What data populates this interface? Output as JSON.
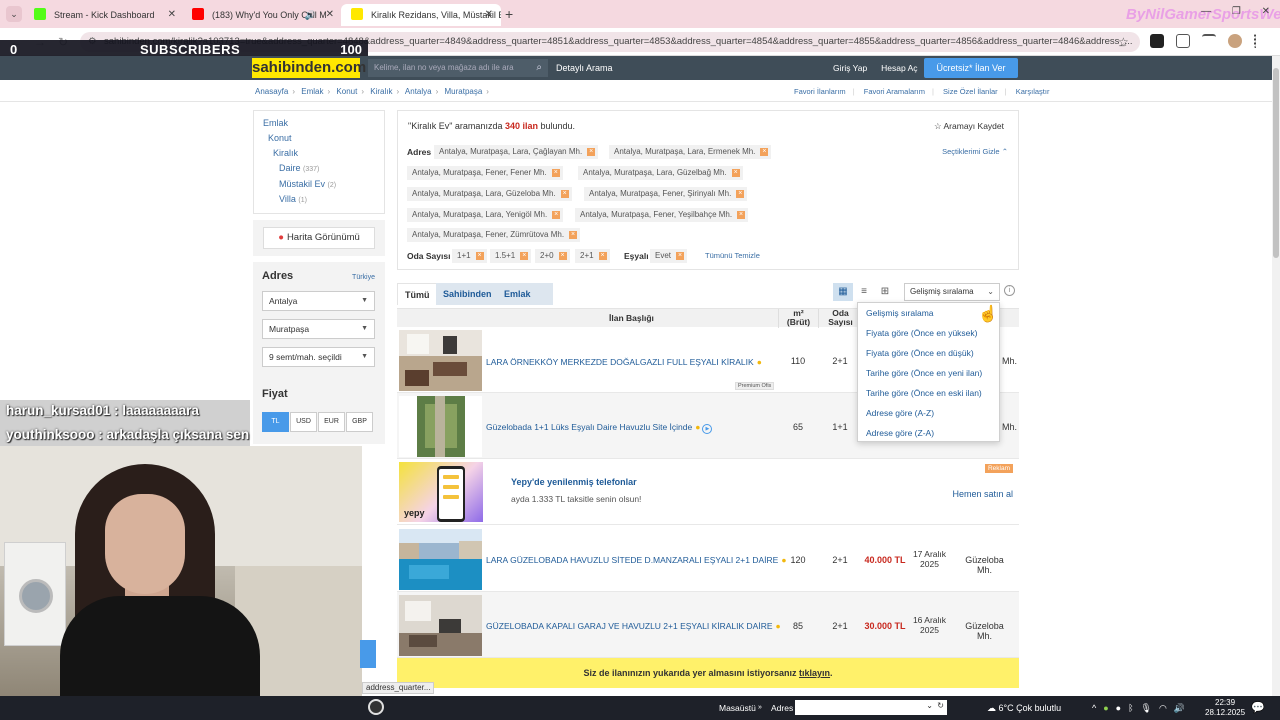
{
  "browser": {
    "tabs": [
      {
        "title": "Stream - Kick Dashboard",
        "favicon_color": "#53fc18",
        "active": false
      },
      {
        "title": "(183) Why'd You Only Call M",
        "favicon_color": "#ff0000",
        "active": false
      },
      {
        "title": "Kiralık Rezidans, Villa, Müstakil E",
        "favicon_color": "#ffe800",
        "active": true
      }
    ],
    "url": "sahibinden.com/kiralik?a103713=true&address_quarter=4848&address_quarter=4849&address_quarter=4851&address_quarter=4853&address_quarter=4854&address_quarter=4855&address_quarter=4856&address_quarter=4846&address_...",
    "watermark": "ByNilGamerSportsWeb"
  },
  "overlay": {
    "sub_left": "0",
    "sub_label": "SUBSCRIBERS",
    "sub_right": "100",
    "chat": [
      {
        "user": "harun_kursad01",
        "text": "laaaaaaaara"
      },
      {
        "user": "youthinksooo",
        "text": "arkadaşla çıksana sen"
      }
    ],
    "url_tooltip": "address_quarter..."
  },
  "header": {
    "logo": "sahibinden.com",
    "search_placeholder": "Kelime, ilan no veya mağaza adı ile ara",
    "detailed_search": "Detaylı Arama",
    "login": "Giriş Yap",
    "register": "Hesap Aç",
    "free_ad": "Ücretsiz* İlan Ver"
  },
  "breadcrumb": [
    "Anasayfa",
    "Emlak",
    "Konut",
    "Kiralık",
    "Antalya",
    "Muratpaşa"
  ],
  "fav_links": [
    "Favori İlanlarım",
    "Favori Aramalarım",
    "Size Özel İlanlar",
    "Karşılaştır"
  ],
  "categories": {
    "emlak": "Emlak",
    "konut": "Konut",
    "kiralik": "Kiralık",
    "daire": "Daire",
    "daire_count": "(337)",
    "mustakil": "Müstakil Ev",
    "mustakil_count": "(2)",
    "villa": "Villa",
    "villa_count": "(1)"
  },
  "map_button": "Harita Görünümü",
  "filters": {
    "adres_title": "Adres",
    "turkiye": "Türkiye",
    "il": "Antalya",
    "ilce": "Muratpaşa",
    "mahalle": "9 semt/mah. seçildi",
    "fiyat_title": "Fiyat",
    "currencies": [
      "TL",
      "USD",
      "EUR",
      "GBP"
    ]
  },
  "results": {
    "query": "\"Kiralık Ev\"",
    "middle": "aramanızda",
    "count": "340 ilan",
    "suffix": "bulundu.",
    "save": "Aramayı Kaydet",
    "hide_selected": "Seçtiklerimi Gizle",
    "adres_label": "Adres",
    "adres_chips": [
      "Antalya, Muratpaşa, Lara, Çağlayan Mh.",
      "Antalya, Muratpaşa, Lara, Ermenek Mh.",
      "Antalya, Muratpaşa, Fener, Fener Mh.",
      "Antalya, Muratpaşa, Lara, Güzelbağ Mh.",
      "Antalya, Muratpaşa, Lara, Güzeloba Mh.",
      "Antalya, Muratpaşa, Fener, Şirinyalı Mh.",
      "Antalya, Muratpaşa, Lara, Yenigöl Mh.",
      "Antalya, Muratpaşa, Fener, Yeşilbahçe Mh.",
      "Antalya, Muratpaşa, Fener, Zümrütova Mh."
    ],
    "oda_label": "Oda Sayısı",
    "oda_chips": [
      "1+1",
      "1.5+1",
      "2+0",
      "2+1"
    ],
    "esyali_label": "Eşyalı",
    "esyali_chip": "Evet",
    "clear_all": "Tümünü Temizle"
  },
  "list_tabs": [
    "Tümü",
    "Sahibinden",
    "Emlak Ofisinden"
  ],
  "sort": {
    "selected": "Gelişmiş sıralama",
    "options": [
      "Gelişmiş sıralama",
      "Fiyata göre (Önce en yüksek)",
      "Fiyata göre (Önce en düşük)",
      "Tarihe göre (Önce en yeni ilan)",
      "Tarihe göre (Önce en eski ilan)",
      "Adrese göre (A-Z)",
      "Adrese göre (Z-A)"
    ]
  },
  "table": {
    "col_title": "İlan Başlığı",
    "col_m2": "m²",
    "col_m2_sub": "(Brüt)",
    "col_oda": "Oda",
    "col_oda_sub": "Sayısı",
    "listings": [
      {
        "title": "LARA ÖRNEKKÖY MERKEZDE DOĞALGAZLI FULL EŞYALI KİRALIK",
        "m2": "110",
        "oda": "2+1",
        "price": "",
        "date1": "",
        "date2": "",
        "loc": "Mh.",
        "badge": "Premium Ofis"
      },
      {
        "title": "Güzelobada 1+1 Lüks Eşyalı Daire Havuzlu Site İçinde",
        "m2": "65",
        "oda": "1+1",
        "price": "",
        "date1": "",
        "date2": "",
        "loc": "Mh.",
        "badge": ""
      },
      {
        "title": "LARA GÜZELOBADA HAVUZLU SİTEDE D.MANZARALI EŞYALI 2+1 DAİRE",
        "m2": "120",
        "oda": "2+1",
        "price": "40.000 TL",
        "date1": "17 Aralık",
        "date2": "2025",
        "loc": "Güzeloba Mh.",
        "badge": ""
      },
      {
        "title": "GÜZELOBADA KAPALI GARAJ VE HAVUZLU 2+1 EŞYALI KİRALIK DAİRE",
        "m2": "85",
        "oda": "2+1",
        "price": "30.000 TL",
        "date1": "16 Aralık",
        "date2": "2025",
        "loc": "Güzeloba Mh.",
        "badge": ""
      }
    ]
  },
  "ad": {
    "logo": "yepy",
    "title": "Yepy'de yenilenmiş telefonlar",
    "subtitle": "ayda 1.333 TL taksitle senin olsun!",
    "tag": "Reklam",
    "cta": "Hemen satın al"
  },
  "promo_text": "Siz de ilanınızın yukarıda yer almasını istiyorsanız",
  "promo_link": "tıklayın",
  "taskbar": {
    "desktop": "Masaüstü",
    "address": "Adres",
    "weather": "6°C  Çok bulutlu",
    "time": "22:39",
    "date": "28.12.2025"
  },
  "colors": {
    "header_bg": "#3f4d58",
    "logo_yellow": "#ffe800",
    "link_blue": "#1f5b98",
    "price_red": "#c8281e",
    "chip_x": "#f3a25b",
    "primary_button": "#489ae9"
  }
}
